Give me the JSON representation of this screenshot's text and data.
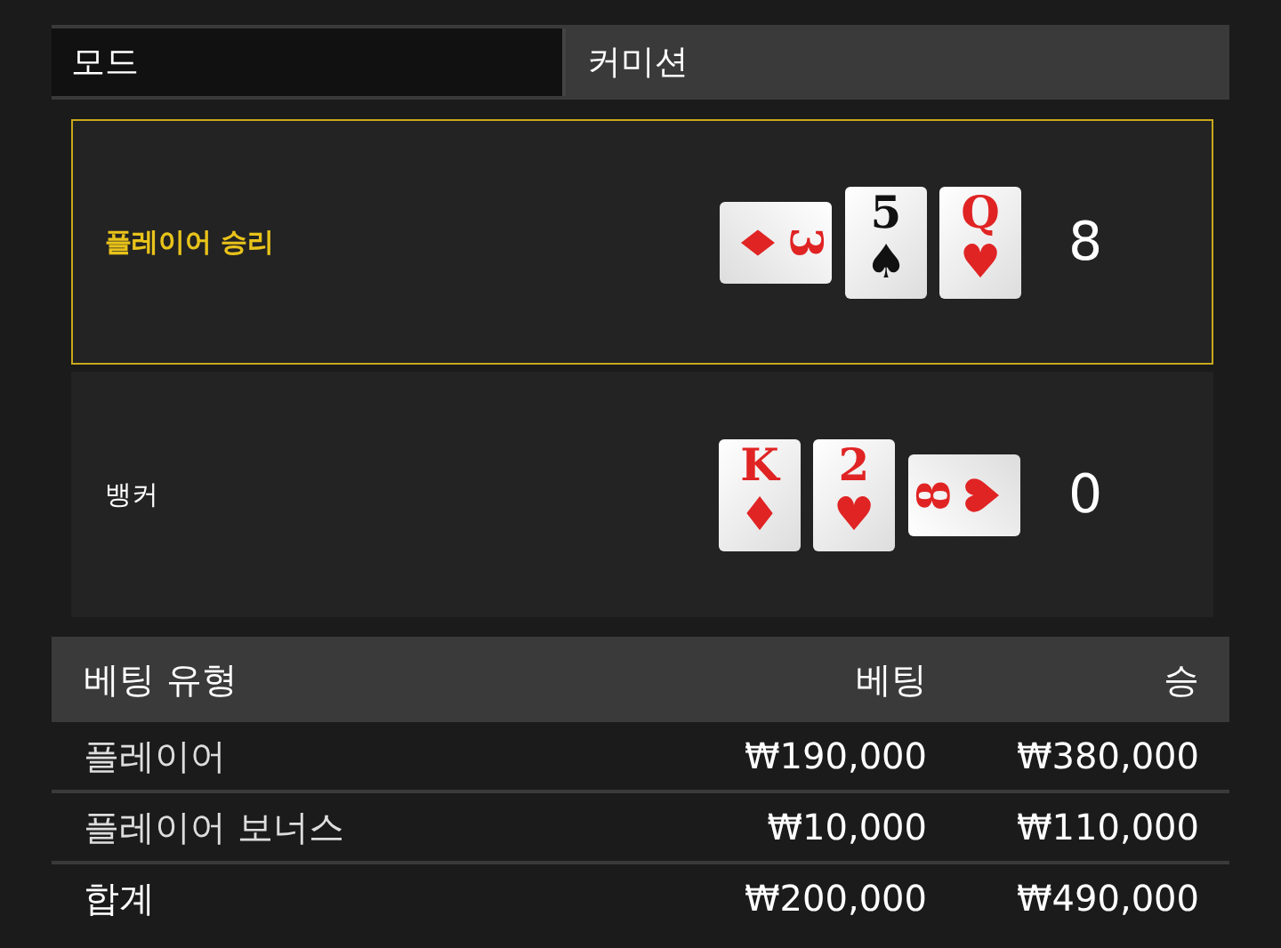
{
  "mode": {
    "label": "모드",
    "value": "커미션"
  },
  "hands": [
    {
      "label": "플레이어 승리",
      "winner": true,
      "score": "8",
      "cards": [
        {
          "rank": "3",
          "suit": "♦",
          "color": "#e02424",
          "kind": "sideways-right"
        },
        {
          "rank": "5",
          "suit": "♠",
          "color": "#111111",
          "kind": "upright"
        },
        {
          "rank": "Q",
          "suit": "♥",
          "color": "#e02424",
          "kind": "upright"
        }
      ]
    },
    {
      "label": "뱅커",
      "winner": false,
      "score": "0",
      "cards": [
        {
          "rank": "K",
          "suit": "♦",
          "color": "#e02424",
          "kind": "upright"
        },
        {
          "rank": "2",
          "suit": "♥",
          "color": "#e02424",
          "kind": "upright"
        },
        {
          "rank": "8",
          "suit": "♥",
          "color": "#e02424",
          "kind": "sideways-left"
        }
      ]
    }
  ],
  "bets": {
    "columns": [
      "베팅 유형",
      "베팅",
      "승"
    ],
    "rows": [
      {
        "type": "플레이어",
        "bet": "₩190,000",
        "win": "₩380,000"
      },
      {
        "type": "플레이어 보너스",
        "bet": "₩10,000",
        "win": "₩110,000"
      }
    ],
    "total": {
      "type": "합계",
      "bet": "₩200,000",
      "win": "₩490,000"
    }
  }
}
